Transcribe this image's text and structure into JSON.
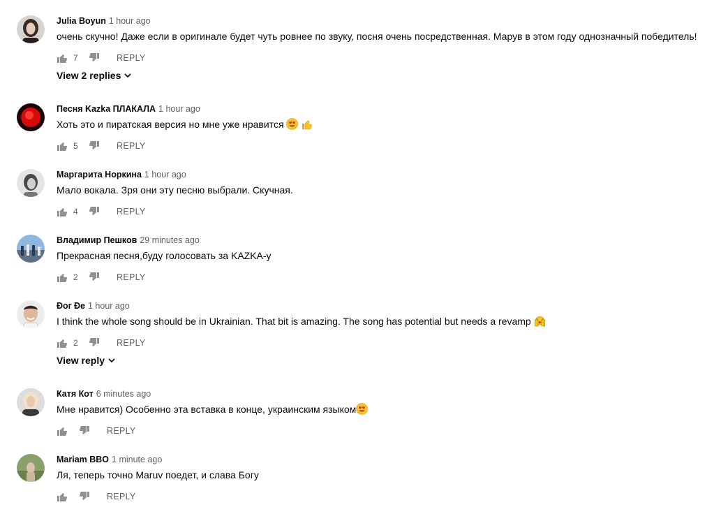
{
  "comments": [
    {
      "author": "Julia Boyun",
      "time": "1 hour ago",
      "text": "очень скучно! Даже если в оригинале будет чуть ровнее по звуку, посня очень посредственная. Марув в этом году однозначный победитель!",
      "likes": "7",
      "reply_label": "REPLY",
      "view_replies": "View 2 replies"
    },
    {
      "author": "Песня Kazka ПЛАКАЛА",
      "time": "1 hour ago",
      "text": "Хоть это и пиратская версия но мне уже нравится",
      "emojis": [
        "heart-eyes-emoji",
        "thumbs-up-emoji"
      ],
      "likes": "5",
      "reply_label": "REPLY"
    },
    {
      "author": "Маргарита Норкина",
      "time": "1 hour ago",
      "text": "Мало вокала. Зря они эту песню выбрали. Скучная.",
      "likes": "4",
      "reply_label": "REPLY"
    },
    {
      "author": "Владимир Пешков",
      "time": "29 minutes ago",
      "text": "Прекрасная песня,буду голосовать за KAZKA-у",
      "likes": "2",
      "reply_label": "REPLY"
    },
    {
      "author": "Đor Đe",
      "time": "1 hour ago",
      "text": "I think the whole song should be in Ukrainian. That bit is amazing. The song has potential but needs a revamp",
      "emojis": [
        "raised-hands-emoji"
      ],
      "likes": "2",
      "reply_label": "REPLY",
      "view_replies": "View reply"
    },
    {
      "author": "Катя Кот",
      "time": "6 minutes ago",
      "text": "Мне нравится) Особенно эта вставка в конце, украинским языком",
      "emojis": [
        "heart-eyes-emoji"
      ],
      "likes": "",
      "reply_label": "REPLY"
    },
    {
      "author": "Mariam BBO",
      "time": "1 minute ago",
      "text": "Ля, теперь точно Maruv поедет, и слава Богу",
      "likes": "",
      "reply_label": "REPLY"
    }
  ],
  "colors": {
    "text_primary": "#0a0a0a",
    "text_secondary": "#606060",
    "icon": "#909090"
  }
}
